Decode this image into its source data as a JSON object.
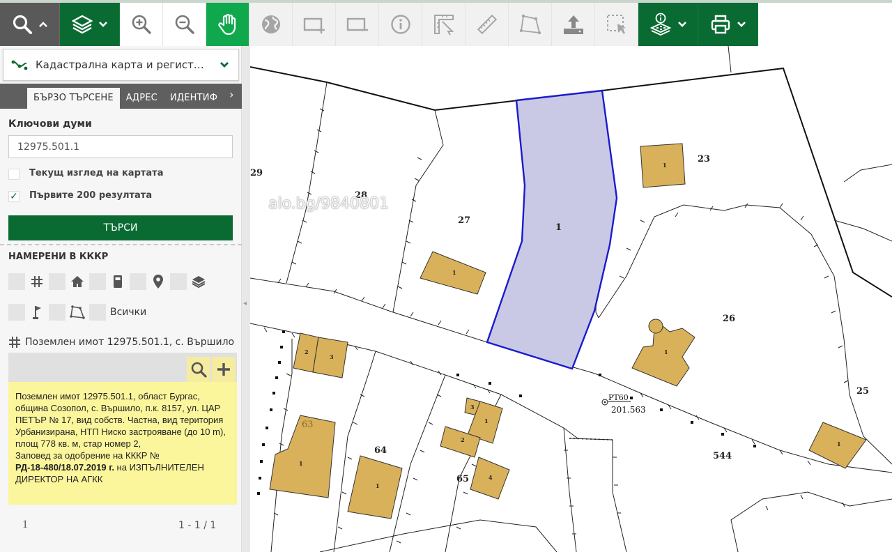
{
  "toolbar": {
    "search": "search-icon",
    "layers": "layers-icon",
    "zoom_in": "zoom-in-icon",
    "zoom_out": "zoom-out-icon",
    "pan": "hand-icon",
    "globe": "globe-icon",
    "rect_add": "rect-add-icon",
    "rect_remove": "rect-remove-icon",
    "info": "info-icon",
    "measure_area": "measure-area-icon",
    "ruler": "ruler-icon",
    "polygon": "polygon-icon",
    "upload": "upload-icon",
    "select": "select-icon",
    "identify_layers": "identify-layers-icon",
    "print": "print-icon"
  },
  "colors": {
    "brand_green": "#0a6b32",
    "selected_fill": "#c9c9e6",
    "selected_stroke": "#1b1bcc",
    "building_fill": "#d8b15a",
    "info_bg": "#fbf59c"
  },
  "sidebar": {
    "layer_select": "Кадастрална карта и регист…",
    "tabs": [
      {
        "label": "БЪРЗО ТЪРСЕНЕ"
      },
      {
        "label": "АДРЕС"
      },
      {
        "label": "ИДЕНТИФ"
      }
    ],
    "tab_next": "›",
    "keywords_label": "Ключови думи",
    "keywords_value": "12975.501.1",
    "current_view_label": "Текущ изглед на картата",
    "first200_label": "Първите 200 резултата",
    "first200_checked": "✓",
    "search_button": "ТЪРСИ",
    "found_title": "НАМЕРЕНИ В КККР",
    "filter_all": "Всички",
    "result": {
      "title": "Поземлен имот 12975.501.1, с. Вършило",
      "info_text": "Поземлен имот 12975.501.1, област Бургас, община Созопол, с. Вършило, п.к. 8157, ул. ЦАР ПЕТЪР № 17, вид собств. Частна, вид територия Урбанизирана, НТП Ниско застрояване (до 10 m), площ 778 кв. м, стар номер 2,",
      "order_prefix": "Заповед за одобрение на КККР №",
      "order_number": "РД-18-480/18.07.2019 г.",
      "order_suffix": " на ИЗПЪЛНИТЕЛЕН ДИРЕКТОР НА АГКК"
    },
    "page_number": "1",
    "page_range": "1 - 1 / 1"
  },
  "map": {
    "watermark": "alo.bg/9840801",
    "parcel_labels": {
      "p29": "29",
      "p28": "28",
      "p27": "27",
      "p1": "1",
      "p23": "23",
      "p26": "26",
      "p25": "25",
      "p544": "544",
      "p63": "63",
      "p64": "64",
      "p65": "65"
    },
    "building_labels": {
      "b1": "1",
      "b2": "2",
      "b3": "3",
      "b4": "4"
    },
    "point_name": "РТ60",
    "point_value": "201.563"
  }
}
